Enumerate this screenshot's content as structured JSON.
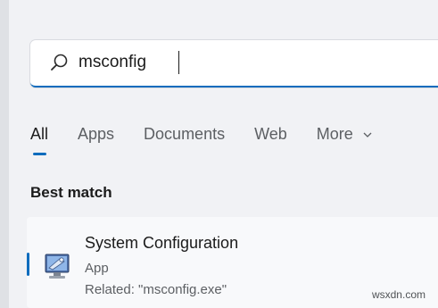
{
  "search": {
    "value": "msconfig",
    "icon": "search-icon"
  },
  "tabs": [
    {
      "label": "All",
      "active": true
    },
    {
      "label": "Apps",
      "active": false
    },
    {
      "label": "Documents",
      "active": false
    },
    {
      "label": "Web",
      "active": false
    },
    {
      "label": "More",
      "active": false
    }
  ],
  "section": {
    "title": "Best match"
  },
  "result": {
    "title": "System Configuration",
    "type": "App",
    "related": "Related: \"msconfig.exe\"",
    "icon": "system-configuration-icon"
  },
  "watermark": "wsxdn.com",
  "colors": {
    "accent": "#0f6cbd",
    "background": "#f1f2f5",
    "card": "#f8f9fb"
  }
}
